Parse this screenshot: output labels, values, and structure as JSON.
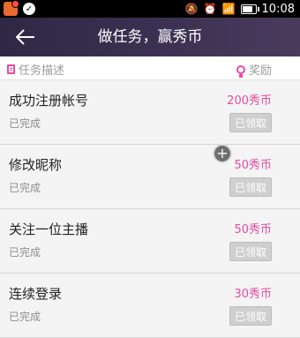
{
  "status_bar": {
    "time": "10:08",
    "icons": [
      "app-notification-icon",
      "check-circle-icon",
      "mute-icon",
      "alarm-icon",
      "wifi-icon",
      "battery-icon"
    ]
  },
  "header": {
    "title": "做任务，赢秀币",
    "back_icon": "back-arrow-icon"
  },
  "columns": {
    "task_desc": "任务描述",
    "reward": "奖励"
  },
  "tasks": [
    {
      "name": "成功注册帐号",
      "status": "已完成",
      "reward": "200秀币",
      "button": "已领取"
    },
    {
      "name": "修改昵称",
      "status": "已完成",
      "reward": "50秀币",
      "button": "已领取"
    },
    {
      "name": "关注一位主播",
      "status": "已完成",
      "reward": "50秀币",
      "button": "已领取"
    },
    {
      "name": "连续登录",
      "status": "已完成",
      "reward": "30秀币",
      "button": "已领取"
    }
  ],
  "colors": {
    "accent": "#e94aa3",
    "header_bg": "#3c3152",
    "button_disabled": "#cfcfcf"
  }
}
